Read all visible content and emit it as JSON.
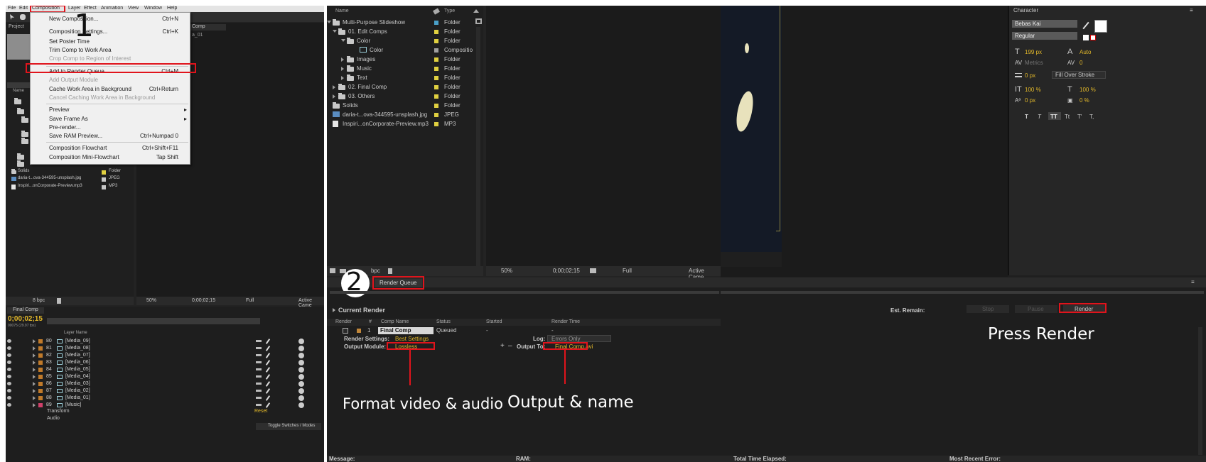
{
  "panel1": {
    "menubar": [
      "File",
      "Edit",
      "Composition",
      "Layer",
      "Effect",
      "Animation",
      "View",
      "Window",
      "Help"
    ],
    "menu": [
      {
        "label": "New Composition...",
        "shortcut": "Ctrl+N",
        "disabled": false
      },
      {
        "label": "Composition Settings...",
        "shortcut": "Ctrl+K",
        "disabled": false
      },
      {
        "label": "Set Poster Time",
        "shortcut": "",
        "disabled": false
      },
      {
        "label": "Trim Comp to Work Area",
        "shortcut": "",
        "disabled": false
      },
      {
        "label": "Crop Comp to Region of Interest",
        "shortcut": "",
        "disabled": true
      },
      {
        "label": "Add to Render Queue",
        "shortcut": "Ctrl+M",
        "disabled": false
      },
      {
        "label": "Add Output Module",
        "shortcut": "",
        "disabled": true
      },
      {
        "label": "Cache Work Area in Background",
        "shortcut": "Ctrl+Return",
        "disabled": false
      },
      {
        "label": "Cancel Caching Work Area in Background",
        "shortcut": "",
        "disabled": true
      },
      {
        "label": "Preview",
        "shortcut": "▸",
        "disabled": false
      },
      {
        "label": "Save Frame As",
        "shortcut": "▸",
        "disabled": false
      },
      {
        "label": "Pre-render...",
        "shortcut": "",
        "disabled": false
      },
      {
        "label": "Save RAM Preview...",
        "shortcut": "Ctrl+Numpad 0",
        "disabled": false
      },
      {
        "label": "Composition Flowchart",
        "shortcut": "Ctrl+Shift+F11",
        "disabled": false
      },
      {
        "label": "Composition Mini-Flowchart",
        "shortcut": "Tap Shift",
        "disabled": false
      }
    ],
    "step_number": "1",
    "project_tab": "Project",
    "comp_tab": "Comp",
    "comp_name_fragment": "a_01",
    "name_header": "Name",
    "project_rows": [
      {
        "label": "Solids",
        "type": "Folder"
      },
      {
        "label": "daria-t...ova-344595-unsplash.jpg",
        "type": "JPEG"
      },
      {
        "label": "Inspiri...onCorporate-Preview.mp3",
        "type": "MP3"
      }
    ],
    "bpc": "8 bpc",
    "zoom": "50%",
    "timecode_small": "0;00;02;15",
    "quality": "Full",
    "camera": "Active Came",
    "timeline_tab": "Final Comp",
    "timecode": "0;00;02;15",
    "fps": "00075 (29.97 fps)",
    "layer_header": "Layer Name",
    "layers": [
      {
        "num": "80",
        "name": "[Media_09]",
        "color": "#c07a2a"
      },
      {
        "num": "81",
        "name": "[Media_08]",
        "color": "#c07a2a"
      },
      {
        "num": "82",
        "name": "[Media_07]",
        "color": "#c07a2a"
      },
      {
        "num": "83",
        "name": "[Media_06]",
        "color": "#c07a2a"
      },
      {
        "num": "84",
        "name": "[Media_05]",
        "color": "#c07a2a"
      },
      {
        "num": "85",
        "name": "[Media_04]",
        "color": "#c07a2a"
      },
      {
        "num": "86",
        "name": "[Media_03]",
        "color": "#c07a2a"
      },
      {
        "num": "87",
        "name": "[Media_02]",
        "color": "#c07a2a"
      },
      {
        "num": "88",
        "name": "[Media_01]",
        "color": "#c07a2a"
      },
      {
        "num": "89",
        "name": "[Music]",
        "color": "#d0406a"
      }
    ],
    "transform": "Transform",
    "reset": "Reset",
    "audio": "Audio",
    "toggle": "Toggle Switches / Modes"
  },
  "panel2": {
    "col_name": "Name",
    "col_type": "Type",
    "rows": [
      {
        "label": "Multi-Purpose Slideshow",
        "type": "Folder",
        "chip": "#4aa0c8"
      },
      {
        "label": "01. Edit Comps",
        "type": "Folder",
        "chip": "#e0d040"
      },
      {
        "label": "Color",
        "type": "Folder",
        "chip": "#e0d040"
      },
      {
        "label": "Color",
        "type": "Compositio",
        "chip": "#a0a0a0"
      },
      {
        "label": "Images",
        "type": "Folder",
        "chip": "#e0d040"
      },
      {
        "label": "Music",
        "type": "Folder",
        "chip": "#e0d040"
      },
      {
        "label": "Text",
        "type": "Folder",
        "chip": "#e0d040"
      },
      {
        "label": "02. Final Comp",
        "type": "Folder",
        "chip": "#e0d040"
      },
      {
        "label": "03. Others",
        "type": "Folder",
        "chip": "#e0d040"
      },
      {
        "label": "Solids",
        "type": "Folder",
        "chip": "#e0d040"
      },
      {
        "label": "daria-t...ova-344595-unsplash.jpg",
        "type": "JPEG",
        "chip": "#e0d040"
      },
      {
        "label": "Inspiri...onCorporate-Preview.mp3",
        "type": "MP3",
        "chip": "#e0d040"
      }
    ],
    "bpc": "bpc",
    "zoom": "50%",
    "timecode": "0;00;02;15",
    "quality": "Full",
    "camera": "Active Came",
    "step_number": "2",
    "render_queue_tab": "Render Queue",
    "current_render": "Current Render",
    "headers": [
      "Render",
      "#",
      "Comp Name",
      "Status",
      "Started",
      "Render Time"
    ],
    "item_num": "1",
    "comp_name": "Final Comp",
    "status": "Queued",
    "started": "-",
    "render_time": "-",
    "render_settings_label": "Render Settings:",
    "render_settings_value": "Best Settings",
    "log_label": "Log:",
    "log_value": "Errors Only",
    "output_module_label": "Output Module:",
    "output_module_value": "Lossless",
    "output_to_label": "Output To:",
    "output_to_value": "Final Comp.avi",
    "annotation_format": "Format video & audio",
    "annotation_output": "Output & name",
    "message_label": "Message:",
    "ram_label": "RAM:"
  },
  "panel3": {
    "character_tab": "Character",
    "font": "Bebas Kai",
    "style": "Regular",
    "size": "199 px",
    "leading": "Auto",
    "kerning": "Metrics",
    "tracking": "0",
    "stroke_width": "0 px",
    "stroke_mode": "Fill Over Stroke",
    "vscale": "100 %",
    "hscale": "100 %",
    "baseline": "0 px",
    "tsume": "0 %",
    "styles": [
      "T",
      "T",
      "TT",
      "Tt",
      "T'",
      "T,"
    ],
    "est_remain": "Est. Remain:",
    "stop": "Stop",
    "pause": "Pause",
    "render": "Render",
    "annotation_render": "Press Render",
    "total_time": "Total Time Elapsed:",
    "recent_error": "Most Recent Error:"
  }
}
